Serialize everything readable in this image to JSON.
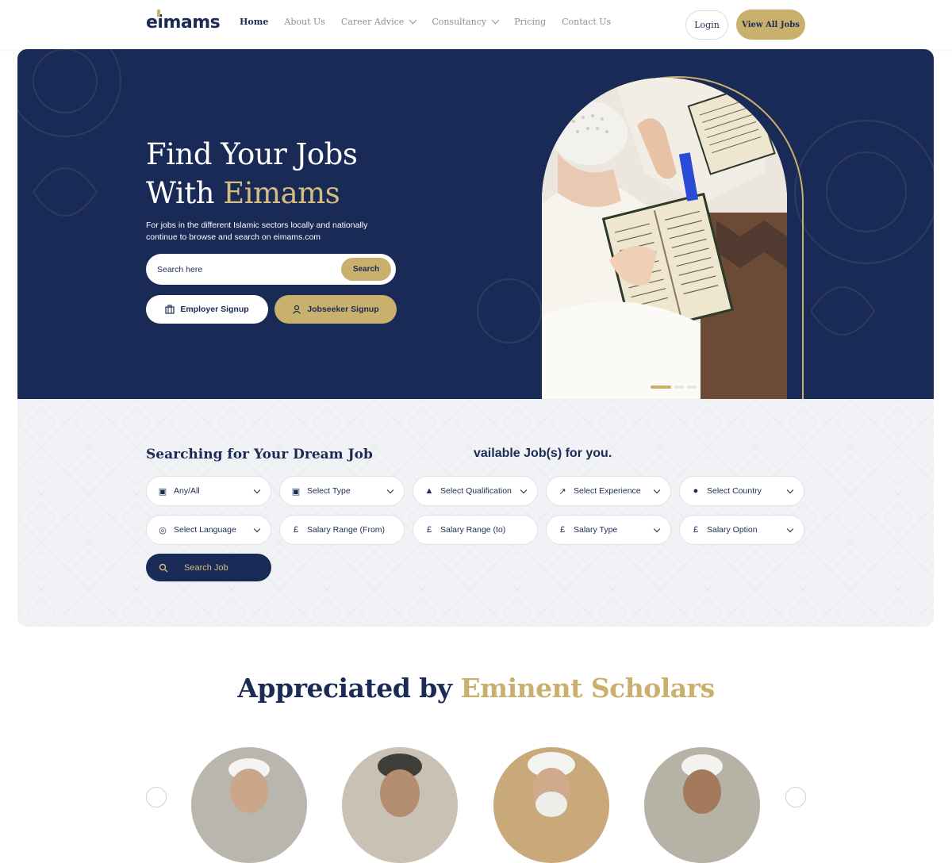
{
  "brand": {
    "logo_text": "eimams"
  },
  "nav": {
    "items": [
      {
        "label": "Home",
        "active": true,
        "dropdown": false
      },
      {
        "label": "About Us",
        "active": false,
        "dropdown": false
      },
      {
        "label": "Career Advice",
        "active": false,
        "dropdown": true
      },
      {
        "label": "Consultancy",
        "active": false,
        "dropdown": true
      },
      {
        "label": "Pricing",
        "active": false,
        "dropdown": false
      },
      {
        "label": "Contact Us",
        "active": false,
        "dropdown": false
      }
    ],
    "login_label": "Login",
    "all_jobs_label": "View All Jobs"
  },
  "hero": {
    "title_line1": "Find Your Jobs",
    "title_line2_prefix": "With ",
    "title_line2_highlight": "Eimams",
    "subtitle_line1": "For jobs in the different Islamic sectors locally and nationally",
    "subtitle_line2": "continue to browse and search on eimams.com",
    "search_placeholder": "Search here",
    "search_button": "Search",
    "employer_signup": "Employer Signup",
    "jobseeker_signup": "Jobseeker Signup",
    "slides": 3,
    "active_slide": 1
  },
  "job_search": {
    "title": "Searching for Your Dream Job",
    "subtitle_partial": "vailable Job(s) for you.",
    "filters_row1": [
      {
        "label": "Any/All",
        "icon": "briefcase-icon"
      },
      {
        "label": "Select Type",
        "icon": "briefcase-icon"
      },
      {
        "label": "Select Qualification",
        "icon": "graduation-cap-icon"
      },
      {
        "label": "Select Experience",
        "icon": "trend-up-icon"
      },
      {
        "label": "Select Country",
        "icon": "map-pin-icon"
      }
    ],
    "filters_row2": [
      {
        "label": "Select Language",
        "icon": "globe-icon",
        "dropdown": true
      },
      {
        "label": "Salary Range (From)",
        "icon": "pound-icon",
        "dropdown": false
      },
      {
        "label": "Salary Range (to)",
        "icon": "pound-icon",
        "dropdown": false
      },
      {
        "label": "Salary Type",
        "icon": "pound-icon",
        "dropdown": true
      },
      {
        "label": "Salary Option",
        "icon": "pound-icon",
        "dropdown": true
      }
    ],
    "search_button": "Search Job"
  },
  "scholars": {
    "title_prefix": "Appreciated by ",
    "title_highlight": "Eminent Scholars"
  },
  "colors": {
    "navy": "#1a2a57",
    "gold": "#c9b16d",
    "panel": "#f1f2f5"
  }
}
